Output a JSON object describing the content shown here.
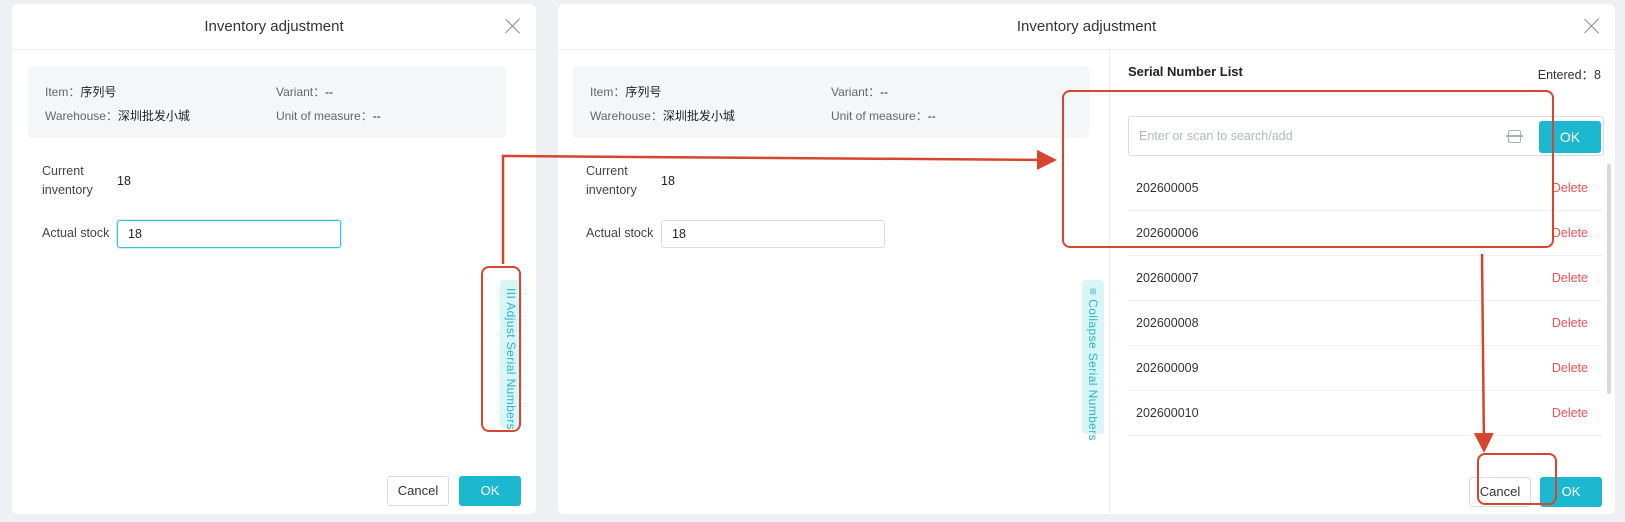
{
  "left_dialog": {
    "title": "Inventory adjustment",
    "info": {
      "item_label": "Item：",
      "item_value": "序列号",
      "variant_label": "Variant：",
      "variant_value": "--",
      "warehouse_label": "Warehouse：",
      "warehouse_value": "深圳批发小城",
      "uom_label": "Unit of measure：",
      "uom_value": "--"
    },
    "current_inventory_label_1": "Current",
    "current_inventory_label_2": "inventory",
    "current_inventory_value": "18",
    "actual_stock_label": "Actual stock",
    "actual_stock_value": "18",
    "side_tab_label": "III Adjust Serial Numbers",
    "cancel_label": "Cancel",
    "ok_label": "OK"
  },
  "right_dialog": {
    "title": "Inventory adjustment",
    "info": {
      "item_label": "Item：",
      "item_value": "序列号",
      "variant_label": "Variant：",
      "variant_value": "--",
      "warehouse_label": "Warehouse：",
      "warehouse_value": "深圳批发小城",
      "uom_label": "Unit of measure：",
      "uom_value": "--"
    },
    "current_inventory_label_1": "Current",
    "current_inventory_label_2": "inventory",
    "current_inventory_value": "18",
    "actual_stock_label": "Actual stock",
    "actual_stock_value": "18",
    "side_tab_label": "≡ Collapse Serial Numbers",
    "serial_panel": {
      "title": "Serial Number List",
      "entered_label": "Entered：8",
      "search_placeholder": "Enter or scan to search/add",
      "search_ok_label": "OK",
      "serials": [
        {
          "number": "202600005",
          "action": "Delete"
        },
        {
          "number": "202600006",
          "action": "Delete"
        },
        {
          "number": "202600007",
          "action": "Delete"
        },
        {
          "number": "202600008",
          "action": "Delete"
        },
        {
          "number": "202600009",
          "action": "Delete"
        },
        {
          "number": "202600010",
          "action": "Delete"
        }
      ]
    },
    "cancel_label": "Cancel",
    "ok_label": "OK"
  },
  "colors": {
    "accent": "#1bb8cf",
    "annotation": "#d54630",
    "delete": "#f05454"
  },
  "icons": [
    "close-icon",
    "scan-icon"
  ]
}
